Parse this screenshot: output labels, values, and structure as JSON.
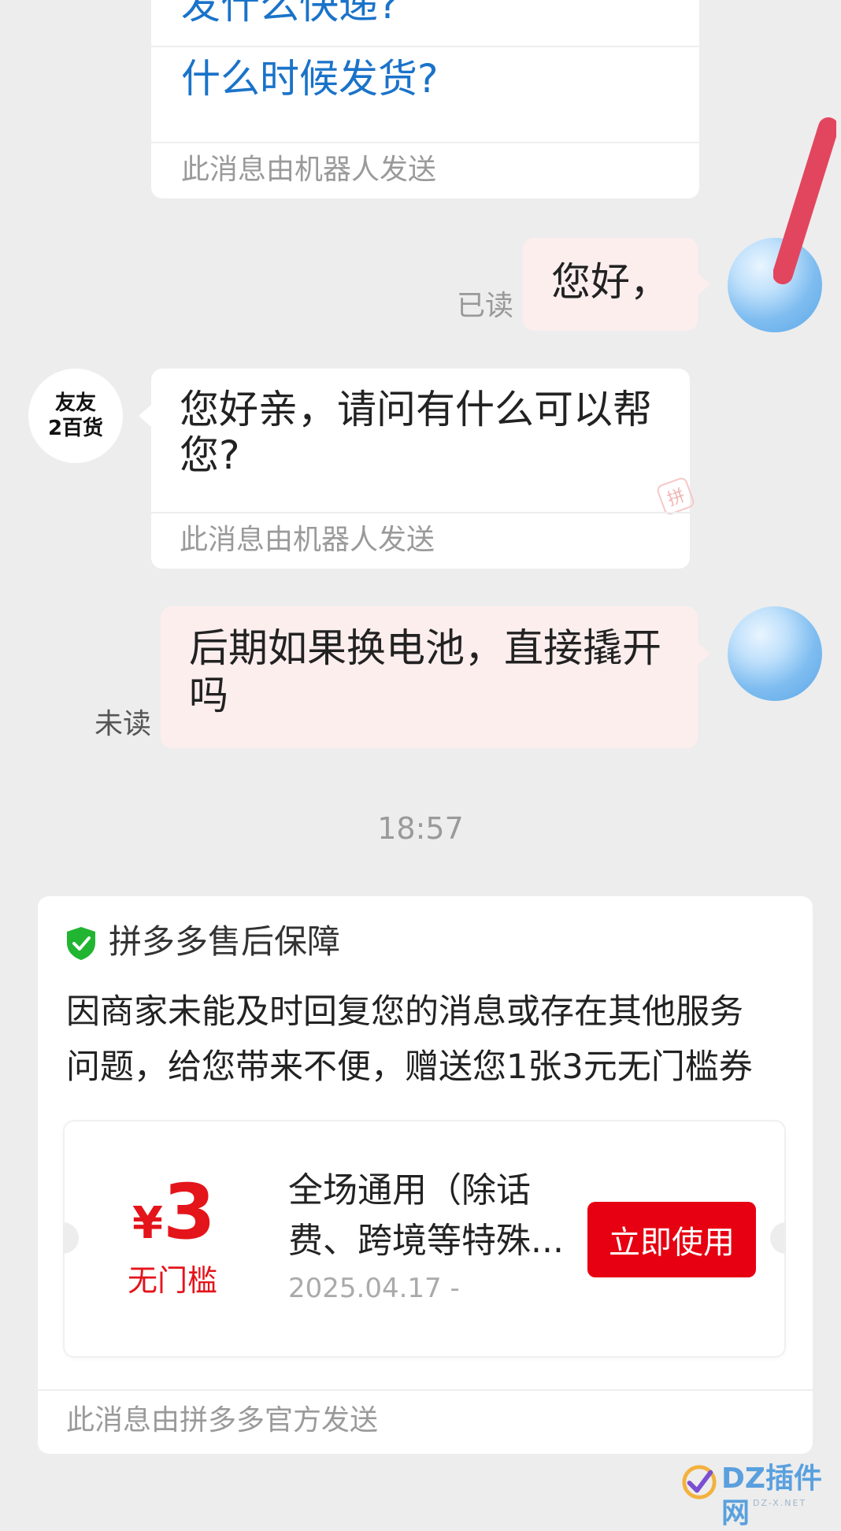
{
  "robot_card": {
    "faq_partial": "发什么快递?",
    "faq_item": "什么时候发货?",
    "robot_note": "此消息由机器人发送"
  },
  "messages": [
    {
      "side": "right",
      "text": "您好，",
      "status": "已读"
    },
    {
      "side": "left",
      "shop_line1": "友友",
      "shop_line2": "2百货",
      "line1": "您好亲，请问有什么可以帮",
      "line2": "您?",
      "note": "此消息由机器人发送",
      "watermark": "拼"
    },
    {
      "side": "right",
      "line1": "后期如果换电池，直接撬开",
      "line2": "吗",
      "status": "未读"
    }
  ],
  "timestamp": "18:57",
  "after_sale": {
    "title": "拼多多售后保障",
    "body_line1": "因商家未能及时回复您的消息或存在其他服务",
    "body_line2": "问题，给您带来不便，赠送您1张3元无门槛券",
    "coupon": {
      "currency": "¥",
      "amount": "3",
      "threshold": "无门槛",
      "desc_line1": "全场通用（除话",
      "desc_line2": "费、跨境等特殊...",
      "date": "2025.04.17 -",
      "button": "立即使用"
    },
    "footer": "此消息由拼多多官方发送"
  },
  "watermark": {
    "brand": "DZ插件网",
    "sub": "DZ-X.NET"
  },
  "colors": {
    "background": "#ededed",
    "link": "#1a73c9",
    "accent_red": "#e60012",
    "bubble_self": "#fdeeee",
    "shield_green": "#21b532"
  }
}
